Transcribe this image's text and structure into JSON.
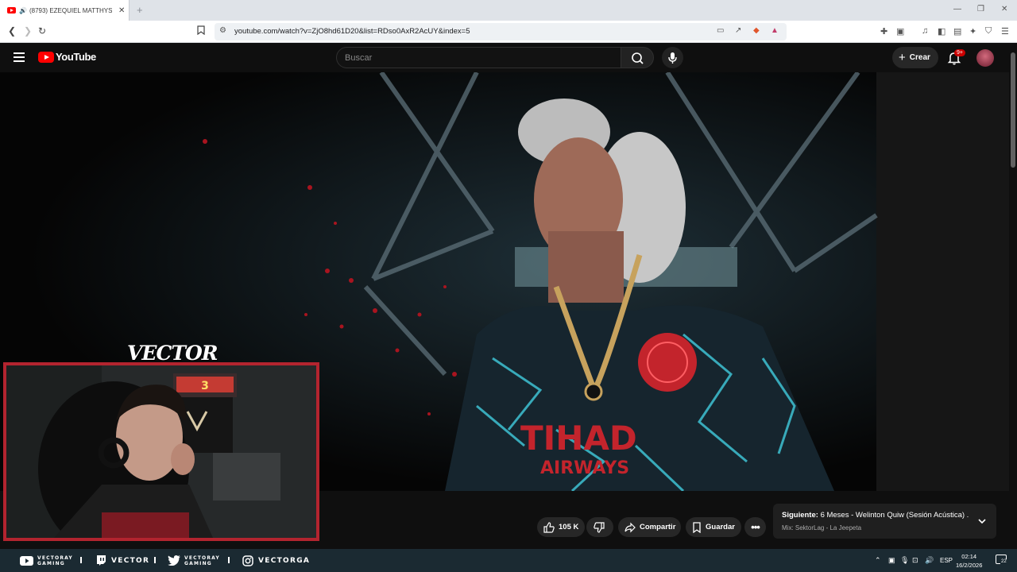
{
  "browser": {
    "tab": {
      "title": "(8793) EZEQUIEL MATTHYSS...",
      "close_icon": "close-icon",
      "new_tab_icon": "plus-icon"
    },
    "address": {
      "url": "youtube.com/watch?v=ZjO8hd61D20&list=RDso0AxR2AcUY&index=5"
    }
  },
  "youtube": {
    "logo_text": "YouTube",
    "search": {
      "placeholder": "Buscar"
    },
    "create_label": "Crear",
    "notifications_count": "9+",
    "actions": {
      "likes": "105 K",
      "share_label": "Compartir",
      "save_label": "Guardar"
    },
    "up_next": {
      "prefix": "Siguiente:",
      "title": "6 Meses - Welinton Quiw (Sesión Acústica) ...",
      "subtitle": "Mix: SektorLag - La Jeepeta"
    }
  },
  "overlay": {
    "brand": "VECTOR",
    "arcade_sign": "3"
  },
  "stream_bar": {
    "youtube": [
      "VECTORAY",
      "GAMING"
    ],
    "twitch": "VECTOR",
    "twitter": [
      "VECTORAY",
      "GAMING"
    ],
    "instagram": "VECTORGA"
  },
  "system_tray": {
    "language": "ESP",
    "time": "02:14",
    "date": "16/2/2026",
    "notif_count": "22"
  },
  "colors": {
    "yt_red": "#ff0000",
    "frame_red": "#b3242f",
    "taskbar": "#1b2a32"
  }
}
